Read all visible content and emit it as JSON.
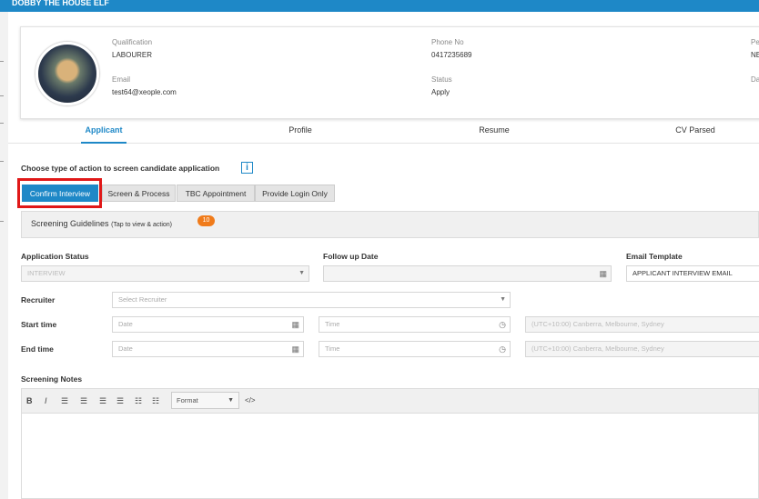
{
  "window": {
    "title": "DOBBY THE HOUSE ELF"
  },
  "profile": {
    "qualification_label": "Qualification",
    "qualification_value": "LABOURER",
    "phone_label": "Phone No",
    "phone_value": "0417235689",
    "col3_label_1": "Pe",
    "col3_value_1": "NE",
    "email_label": "Email",
    "email_value": "test64@xeople.com",
    "status_label": "Status",
    "status_value": "Apply",
    "col3_label_2": "Da"
  },
  "tabs": [
    {
      "label": "Applicant"
    },
    {
      "label": "Profile"
    },
    {
      "label": "Resume"
    },
    {
      "label": "CV Parsed"
    }
  ],
  "screening": {
    "heading": "Choose type of action to screen candidate application",
    "info_icon": "i",
    "actions": [
      "Confirm Interview",
      "Screen & Process",
      "TBC Appointment",
      "Provide Login Only"
    ],
    "guidelines_label": "Screening Guidelines",
    "guidelines_hint": "(Tap to view & action)",
    "guidelines_count": "10"
  },
  "form": {
    "application_status_label": "Application Status",
    "application_status_value": "INTERVIEW",
    "follow_up_label": "Follow up Date",
    "email_template_label": "Email Template",
    "email_template_value": "APPLICANT INTERVIEW EMAIL",
    "recruiter_label": "Recruiter",
    "recruiter_placeholder": "Select Recruiter",
    "start_time_label": "Start time",
    "end_time_label": "End time",
    "date_placeholder": "Date",
    "time_placeholder": "Time",
    "timezone_value": "(UTC+10:00) Canberra, Melbourne, Sydney",
    "screening_notes_label": "Screening Notes"
  },
  "editor": {
    "bold": "B",
    "italic": "I",
    "format_label": "Format",
    "code_label": "</>"
  },
  "colors": {
    "accent": "#1e88c7",
    "highlight": "#e01818",
    "badge": "#f07b1a"
  }
}
